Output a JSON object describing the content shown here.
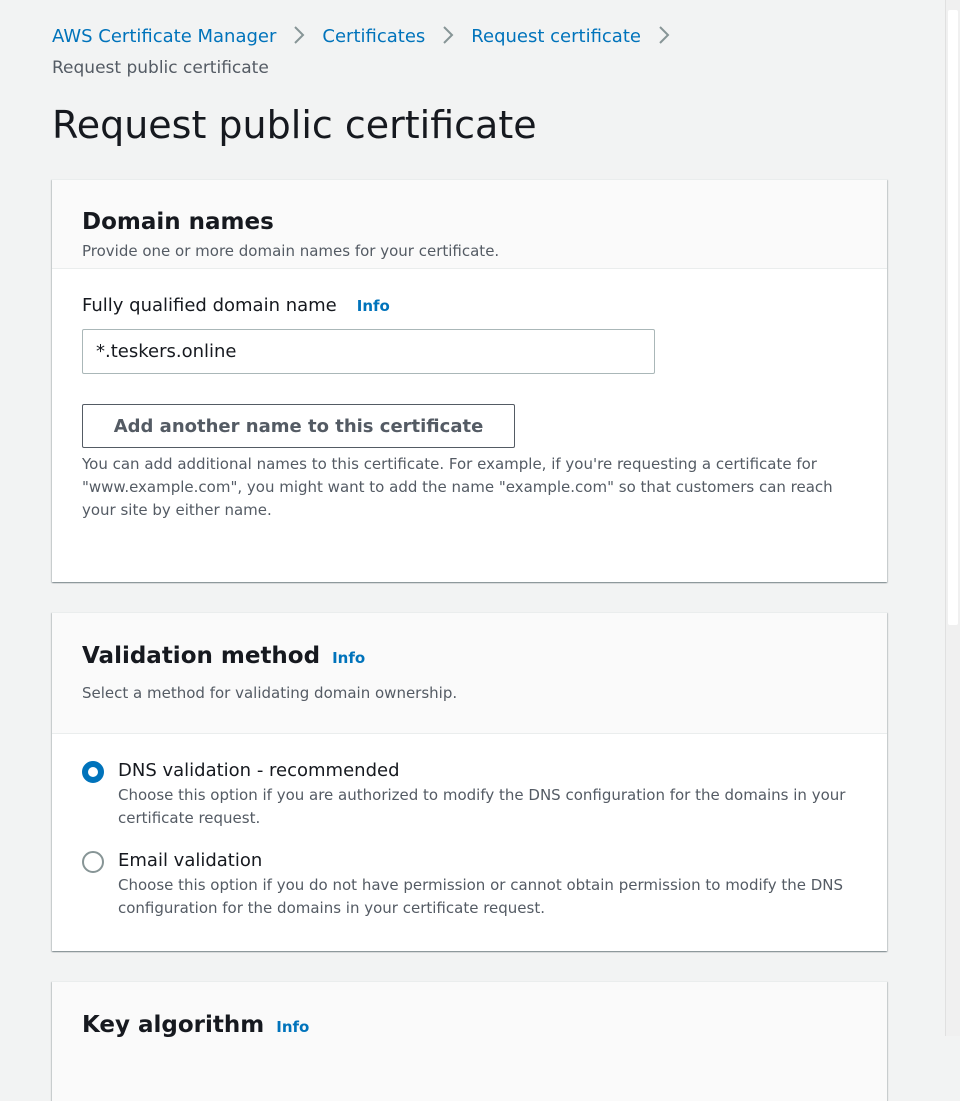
{
  "breadcrumb": {
    "items": [
      "AWS Certificate Manager",
      "Certificates",
      "Request certificate"
    ],
    "current": "Request public certificate"
  },
  "page": {
    "title": "Request public certificate"
  },
  "domain_names": {
    "title": "Domain names",
    "description": "Provide one or more domain names for your certificate.",
    "fqdn_label": "Fully qualified domain name",
    "info_label": "Info",
    "fqdn_value": "*.teskers.online",
    "add_button_label": "Add another name to this certificate",
    "help_text": "You can add additional names to this certificate. For example, if you're requesting a certificate for \"www.example.com\", you might want to add the name \"example.com\" so that customers can reach your site by either name."
  },
  "validation_method": {
    "title": "Validation method",
    "info_label": "Info",
    "description": "Select a method for validating domain ownership.",
    "options": [
      {
        "label": "DNS validation - recommended",
        "description": "Choose this option if you are authorized to modify the DNS configuration for the domains in your certificate request.",
        "selected": true
      },
      {
        "label": "Email validation",
        "description": "Choose this option if you do not have permission or cannot obtain permission to modify the DNS configuration for the domains in your certificate request.",
        "selected": false
      }
    ]
  },
  "key_algorithm": {
    "title": "Key algorithm",
    "info_label": "Info"
  },
  "colors": {
    "link": "#0073bb",
    "page_background": "#f2f3f3",
    "text_primary": "#16191f",
    "text_secondary": "#545b64"
  }
}
